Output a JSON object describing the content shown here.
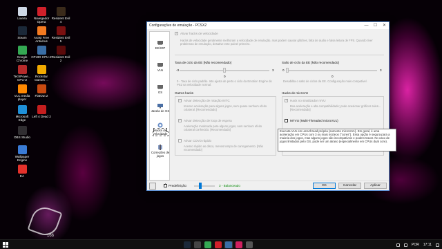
{
  "desktop": {
    "icons": [
      {
        "label": "Lixeira",
        "color": "#cfd8e6"
      },
      {
        "label": "Navegador Opera",
        "color": "#d0202a"
      },
      {
        "label": "Resident Evil 4",
        "color": "#3a2a1a"
      },
      {
        "label": "Steam",
        "color": "#1b2838"
      },
      {
        "label": "Avast Free Antivirus",
        "color": "#f47a20"
      },
      {
        "label": "Resident Evil 5",
        "color": "#7a1010"
      },
      {
        "label": "Google Chrome",
        "color": "#34a853"
      },
      {
        "label": "CPUID CPU-Z",
        "color": "#3a6ea5"
      },
      {
        "label": "Resident Evil 2",
        "color": "#5a0a0a"
      },
      {
        "label": "TechPowe... GPU-Z",
        "color": "#b52b2b"
      },
      {
        "label": "Rockstar Games ...",
        "color": "#f2a900"
      },
      {
        "label": "VLC media player",
        "color": "#ff8800"
      },
      {
        "label": "FlatOut 2",
        "color": "#c84a10"
      },
      {
        "label": "Microsoft Edge",
        "color": "#1e8fd6"
      },
      {
        "label": "Left 4 Dead 2",
        "color": "#c41e1e"
      },
      {
        "label": "OBS Studio",
        "color": "#302e31"
      },
      {
        "label": "Wallpaper Engine",
        "color": "#3a7bd5"
      },
      {
        "label": "EA",
        "color": "#e4312b"
      }
    ],
    "signature_number": "166"
  },
  "dialog": {
    "title": "Configurações de emulação - PCSX2",
    "window_buttons": {
      "minimize": "—",
      "maximize": "☐",
      "close": "✕"
    },
    "nav": [
      {
        "label": "EE/IOP",
        "icon": "chip-icon"
      },
      {
        "label": "VUs",
        "icon": "chip-icon"
      },
      {
        "label": "GS",
        "icon": "chip-icon"
      },
      {
        "label": "Janela de GS",
        "icon": "monitor-icon"
      },
      {
        "label": "Hacks de velocidade",
        "icon": "hack-icon"
      },
      {
        "label": "Correções de jogos",
        "icon": "tools-icon"
      }
    ],
    "speed_hacks": {
      "enable_label": "Ativar hacks de velocidade",
      "description": "Hacks de velocidade geralmente melhoram a velocidade de emulação, mas podem causar glitches, falta de áudio e falsa leitura de FPS. Quando tiver problemas de emulação, desative este painel primeiro.",
      "ee_cycle_rate": {
        "title": "Taxa de ciclo da EE [Não recomendado]",
        "min": "-3",
        "max": "3",
        "value": "0",
        "note": "0 - Taxa de ciclo padrão. Isto ajusta de perto o ciclo da Emotion Engine do PS2 na velocidade normal."
      },
      "ee_cycle_skip": {
        "title": "Salto de ciclo da EE [Não recomendado]",
        "min": "0",
        "max": "3",
        "value": "0",
        "note": "Desabilita o salto de ciclos da EE. Configuração mais compatível."
      },
      "other_hacks": {
        "title": "Outros hacks",
        "intc_label": "Ativar detecção de rotação INTC",
        "intc_desc": "Imenso aceleração para alguns jogos, sem quase nenhum efeito colateral. [Recomendado]",
        "wait_label": "Ativar detecção de loop de espera",
        "wait_desc": "Aceleração moderada para alguns jogos, sem nenhum efeito colateral conhecido. [Recomendado]",
        "cdvd_label": "Ativar CDVD rápido",
        "cdvd_desc": "Acesso rápido ao disco, menos tempo de carregamento. [Não recomendado]"
      },
      "microvu_hacks": {
        "title": "Hacks de microVU",
        "flag_label": "Hack no sinalizador mVU",
        "flag_desc": "Boa aceleração e alta compatibilidade; pode ocasionar gráficos ruins... [Recomendado]",
        "mtvu_label": "MTVU (Multi-Threaded microVU1)"
      },
      "tooltip": "Executa VU1 em uma thread própria (somente microVU1). Em geral, é uma aceleração em CPUs com 3 ou mais núcleos (\"cores\"). Essa opção é segura para a maioria dos jogos, mas alguns jogos são incompatíveis e podem travar. No caso de jogos limitados pelo GS, pode ser um atraso (especialmente em CPUs dual core)."
    },
    "footer": {
      "preset_label": "Predefinição:",
      "preset_value": "3 - Balanceado",
      "preset_color": "#0a8a0a",
      "ok": "OK",
      "cancel": "Cancelar",
      "apply": "Aplicar"
    }
  },
  "taskbar": {
    "apps": [
      {
        "icon": "steam-icon",
        "color": "#1b2838"
      },
      {
        "icon": "game-icon",
        "color": "#444444"
      },
      {
        "icon": "chrome-icon",
        "color": "#34a853"
      },
      {
        "icon": "opera-icon",
        "color": "#d0202a"
      },
      {
        "icon": "pcsx2-icon",
        "color": "#3a6ea5"
      },
      {
        "icon": "music-icon",
        "color": "#d02060"
      },
      {
        "icon": "obs-icon",
        "color": "#555555"
      }
    ],
    "language": "POR",
    "time": "17:11"
  }
}
